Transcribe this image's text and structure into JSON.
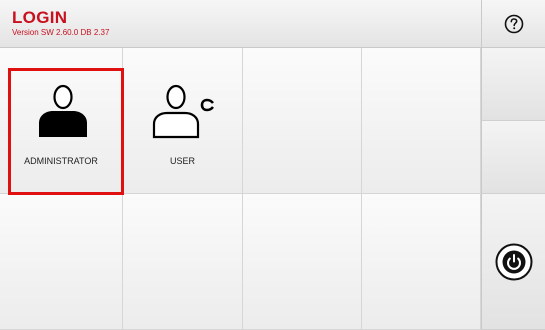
{
  "header": {
    "title": "LOGIN",
    "version": "Version SW 2.60.0 DB 2.37"
  },
  "icons": {
    "help": "question-mark-icon",
    "power": "power-icon",
    "administrator": "administrator-avatar-icon",
    "user": "user-avatar-icon"
  },
  "users": [
    {
      "label": "ADMINISTRATOR",
      "selected": true
    },
    {
      "label": "USER",
      "selected": false
    }
  ],
  "colors": {
    "accent": "#c8101e",
    "selection": "#e01010"
  }
}
